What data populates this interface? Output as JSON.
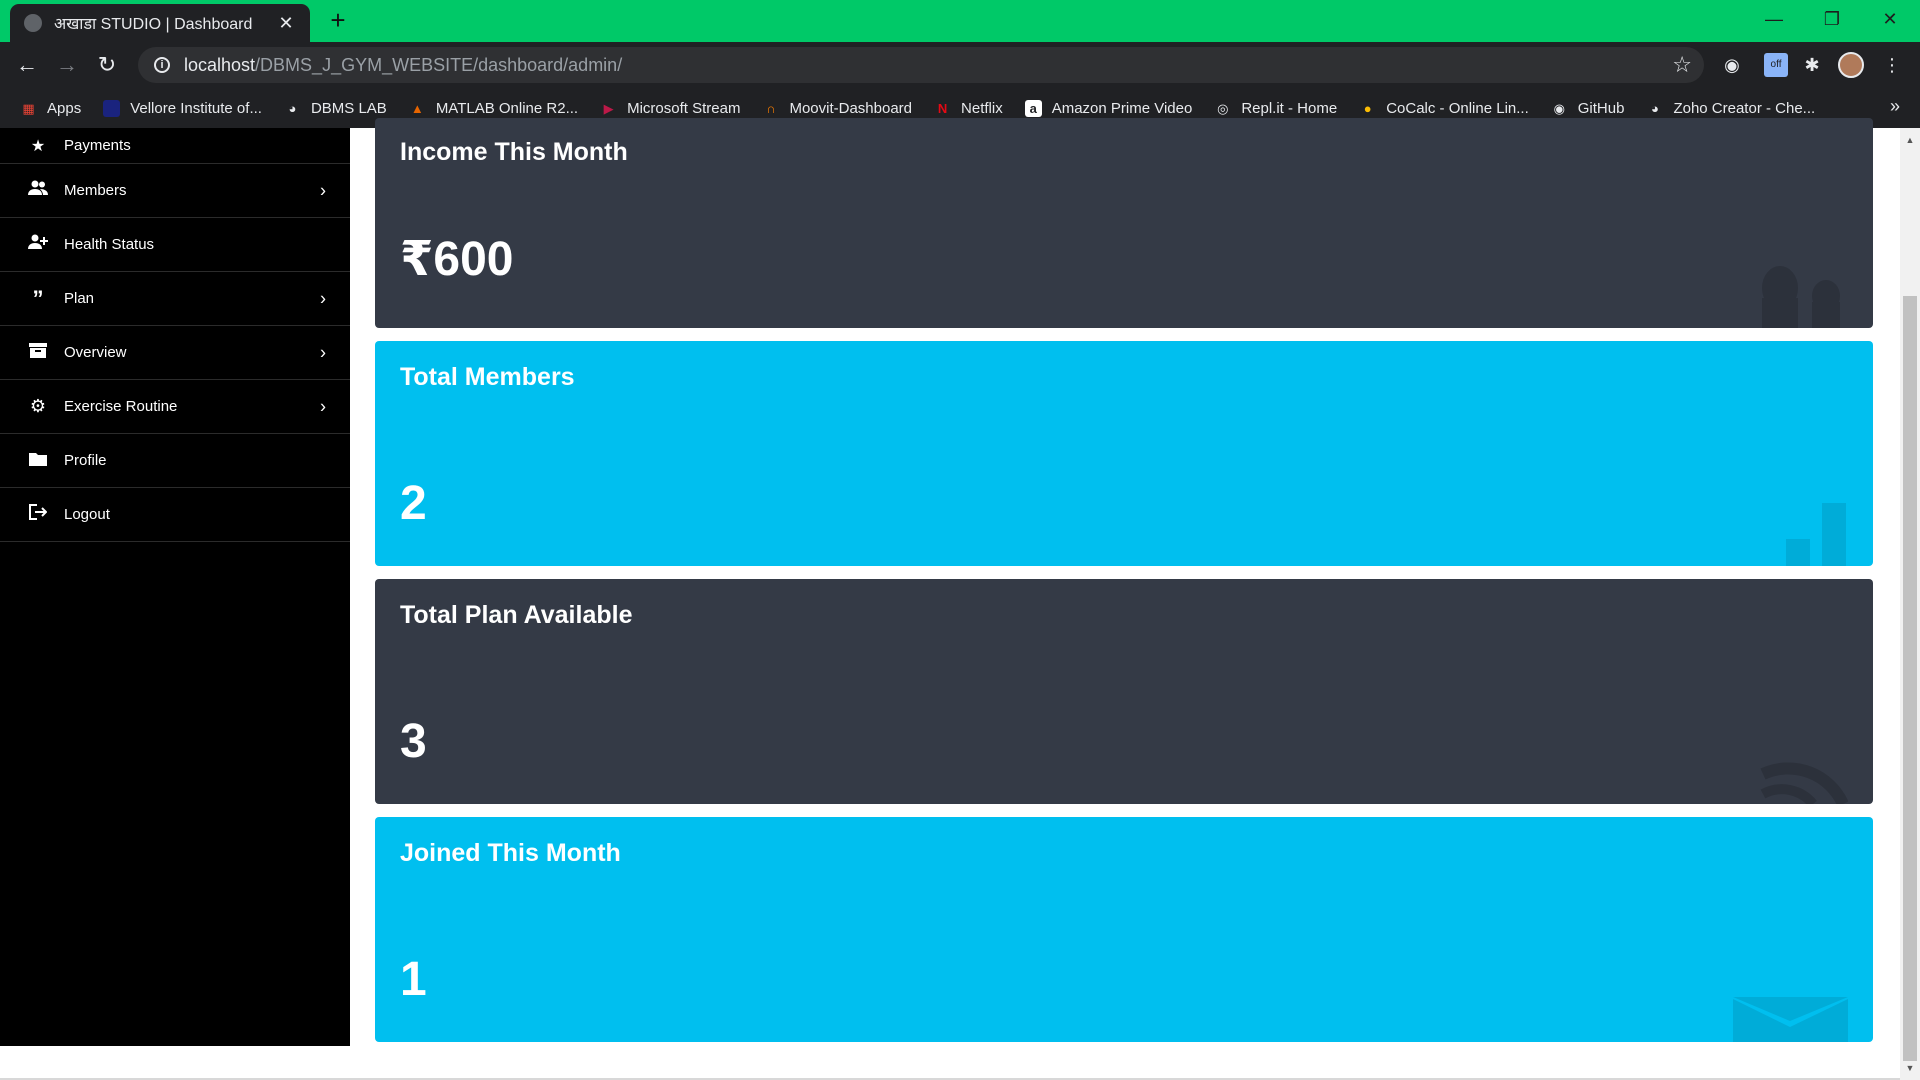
{
  "browser": {
    "tab_title": "अखाडा STUDIO | Dashboard",
    "tab_close": "✕",
    "new_tab": "+",
    "url_host": "localhost",
    "url_path": "/DBMS_J_GYM_WEBSITE/dashboard/admin/",
    "ext_off_label": "off",
    "bookmarks": [
      {
        "label": "Apps",
        "icon": "apps-grid-icon",
        "color": "#ea4335"
      },
      {
        "label": "Vellore Institute of...",
        "icon": "vit-icon",
        "color": "#1a237e"
      },
      {
        "label": "DBMS LAB",
        "icon": "globe-icon",
        "color": "#e8eaed"
      },
      {
        "label": "MATLAB Online R2...",
        "icon": "matlab-icon",
        "color": "#e76500"
      },
      {
        "label": "Microsoft Stream",
        "icon": "stream-icon",
        "color": "#bc1948"
      },
      {
        "label": "Moovit-Dashboard",
        "icon": "moovit-icon",
        "color": "#f57c00"
      },
      {
        "label": "Netflix",
        "icon": "netflix-icon",
        "color": "#e50914"
      },
      {
        "label": "Amazon Prime Video",
        "icon": "amazon-icon",
        "color": "#ffffff"
      },
      {
        "label": "Repl.it - Home",
        "icon": "replit-icon",
        "color": "#e8eaed"
      },
      {
        "label": "CoCalc - Online Lin...",
        "icon": "cocalc-icon",
        "color": "#fbbc04"
      },
      {
        "label": "GitHub",
        "icon": "github-icon",
        "color": "#ffffff"
      },
      {
        "label": "Zoho Creator - Che...",
        "icon": "globe-icon",
        "color": "#e8eaed"
      }
    ]
  },
  "sidebar": {
    "items": [
      {
        "label": "Payments",
        "icon": "star-icon",
        "has_submenu": false
      },
      {
        "label": "Members",
        "icon": "users-icon",
        "has_submenu": true
      },
      {
        "label": "Health Status",
        "icon": "user-plus-icon",
        "has_submenu": false
      },
      {
        "label": "Plan",
        "icon": "quote-icon",
        "has_submenu": true
      },
      {
        "label": "Overview",
        "icon": "archive-icon",
        "has_submenu": true
      },
      {
        "label": "Exercise Routine",
        "icon": "cog-icon",
        "has_submenu": true
      },
      {
        "label": "Profile",
        "icon": "folder-icon",
        "has_submenu": false
      },
      {
        "label": "Logout",
        "icon": "sign-out-icon",
        "has_submenu": false
      }
    ]
  },
  "cards": [
    {
      "title": "Income This Month",
      "value": "₹600",
      "theme": "dark",
      "icon": "users-icon"
    },
    {
      "title": "Total Members",
      "value": "2",
      "theme": "cyan",
      "icon": "bar-chart-icon"
    },
    {
      "title": "Total Plan Available",
      "value": "3",
      "theme": "dark",
      "icon": "rss-icon"
    },
    {
      "title": "Joined This Month",
      "value": "1",
      "theme": "cyan",
      "icon": "envelope-icon"
    }
  ],
  "colors": {
    "tabbar": "#00c968",
    "card_dark": "#343a46",
    "card_cyan": "#00bfef",
    "sidebar": "#000000"
  }
}
